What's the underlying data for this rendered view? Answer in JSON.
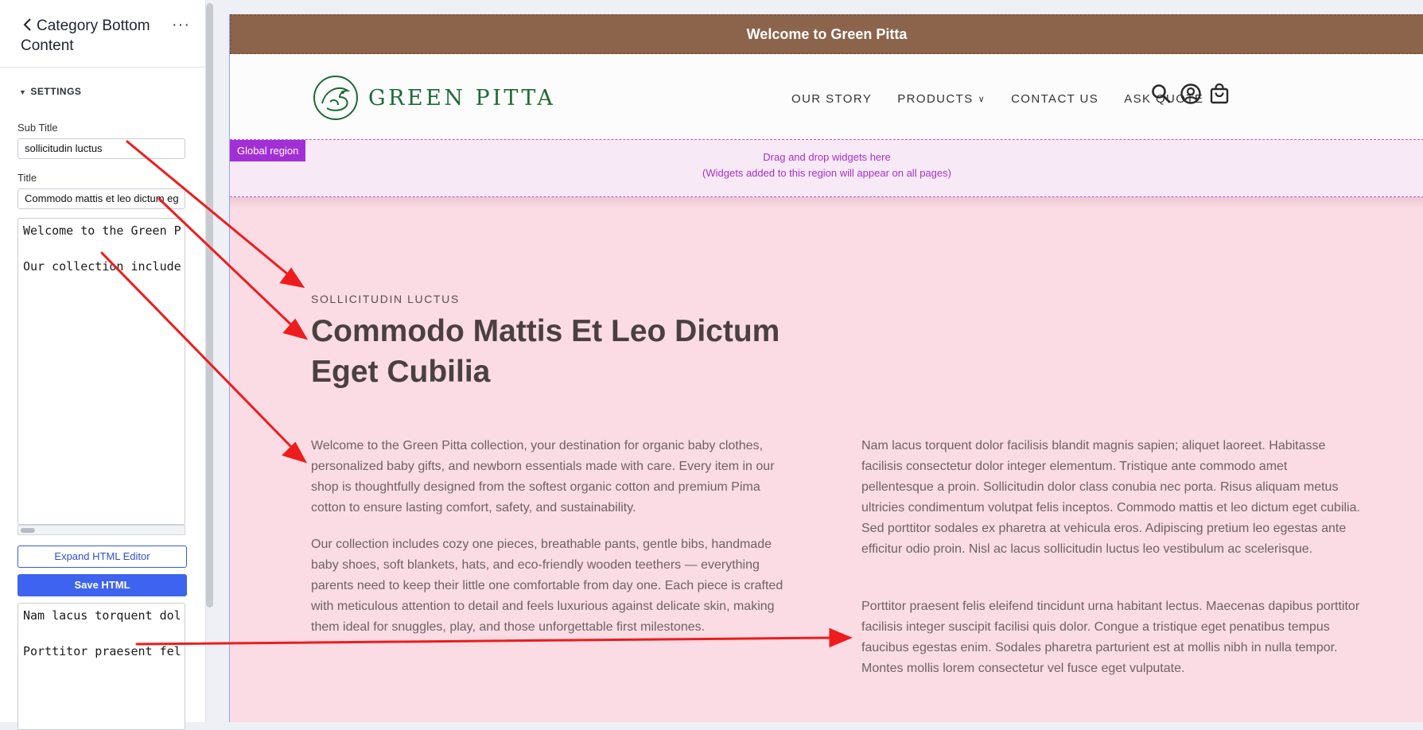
{
  "sidebar": {
    "title": "Category Bottom Content",
    "section_label": "SETTINGS",
    "subtitle_label": "Sub Title",
    "subtitle_value": "sollicitudin luctus",
    "title_label": "Title",
    "title_value": "Commodo mattis et leo dictum eg",
    "html1_line1": "Welcome to the Green P",
    "html1_line2": "Our collection include",
    "expand_button": "Expand HTML Editor",
    "save_button": "Save HTML",
    "html2_line1": "Nam lacus torquent dol",
    "html2_line2": "Porttitor praesent fel"
  },
  "preview": {
    "announcement": "Welcome to Green Pitta",
    "logo_text": "GREEN PITTA",
    "nav": [
      "OUR STORY",
      "PRODUCTS",
      "CONTACT US",
      "ASK QUOTE"
    ],
    "global_region": {
      "badge": "Global region",
      "line1": "Drag and drop widgets here",
      "line2": "(Widgets added to this region will appear on all pages)"
    },
    "content": {
      "subtitle": "SOLLICITUDIN LUCTUS",
      "title": "Commodo Mattis Et Leo Dictum Eget Cubilia",
      "left_p1": "Welcome to the Green Pitta collection, your destination for organic baby clothes, personalized baby gifts, and newborn essentials made with care. Every item in our shop is thoughtfully designed from the softest organic cotton and premium Pima cotton to ensure lasting comfort, safety, and sustainability.",
      "left_p2": "Our collection includes cozy one pieces, breathable pants, gentle bibs, handmade baby shoes, soft blankets, hats, and eco-friendly wooden teethers — everything parents need to keep their little one comfortable from day one. Each piece is crafted with meticulous attention to detail and feels luxurious against delicate skin, making them ideal for snuggles, play, and those unforgettable first milestones.",
      "right_p1": "Nam lacus torquent dolor facilisis blandit magnis sapien; aliquet laoreet. Habitasse facilisis consectetur dolor integer elementum. Tristique ante commodo amet pellentesque a proin. Sollicitudin dolor class conubia nec porta. Risus aliquam metus ultricies condimentum volutpat felis inceptos. Commodo mattis et leo dictum eget cubilia. Sed porttitor sodales ex pharetra at vehicula eros. Adipiscing pretium leo egestas ante efficitur odio proin. Nisl ac lacus sollicitudin luctus leo vestibulum ac scelerisque.",
      "right_p2": "Porttitor praesent felis eleifend tincidunt urna habitant lectus. Maecenas dapibus porttitor facilisis integer suscipit facilisi quis dolor. Congue a tristique eget penatibus tempus faucibus egestas enim. Sodales pharetra parturient est at mollis nibh in nulla tempor. Montes mollis lorem consectetur vel fusce eget vulputate."
    }
  },
  "colors": {
    "announcement_bg": "#8b644b",
    "brand_green": "#1b6b34",
    "content_bg": "#fbdce4",
    "global_region": "#a22ed6",
    "primary_button": "#3d63f0",
    "annotation_arrow": "#ee1c1c"
  }
}
